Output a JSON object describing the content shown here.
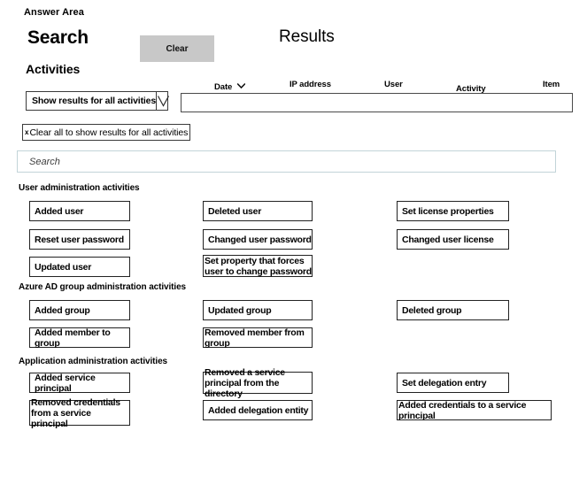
{
  "page": {
    "answer_area_label": "Answer Area"
  },
  "search_panel": {
    "title": "Search",
    "clear_button_label": "Clear",
    "activities_label": "Activities",
    "dropdown": {
      "value": "Show results for all activities",
      "icon": "chevron-down-icon"
    },
    "chip": {
      "close_icon": "x-icon",
      "label": "Clear all to show results for all activities"
    },
    "search_field": {
      "value": "",
      "placeholder": "Search"
    }
  },
  "results_panel": {
    "title": "Results",
    "columns": [
      {
        "label": "Date",
        "sort_icon": "chevron-down-icon"
      },
      {
        "label": "IP address",
        "sort_icon": ""
      },
      {
        "label": "User",
        "sort_icon": ""
      },
      {
        "label": "Activity",
        "sort_icon": ""
      },
      {
        "label": "Item",
        "sort_icon": ""
      }
    ],
    "rows": []
  },
  "activity_groups": [
    {
      "label": "User administration activities",
      "options": [
        "Added user",
        "Deleted user",
        "Set license properties",
        "Reset user password",
        "Changed user password",
        "Changed user license",
        "Updated user",
        "Set property that forces user to change password"
      ]
    },
    {
      "label": "Azure AD group administration activities",
      "options": [
        "Added group",
        "Updated group",
        "Deleted group",
        "Added member to group",
        "Removed member from group"
      ]
    },
    {
      "label": "Application administration activities",
      "options": [
        "Added service principal",
        "Removed a service principal from the directory",
        "Set delegation entry",
        "Removed credentials from a service principal",
        "Added delegation entity",
        "Added credentials to a service principal"
      ]
    }
  ],
  "colors": {
    "clear_button_bg": "#c8c8c8",
    "box_border": "#222222",
    "search_border": "#c2d4d8",
    "text": "#000000"
  }
}
